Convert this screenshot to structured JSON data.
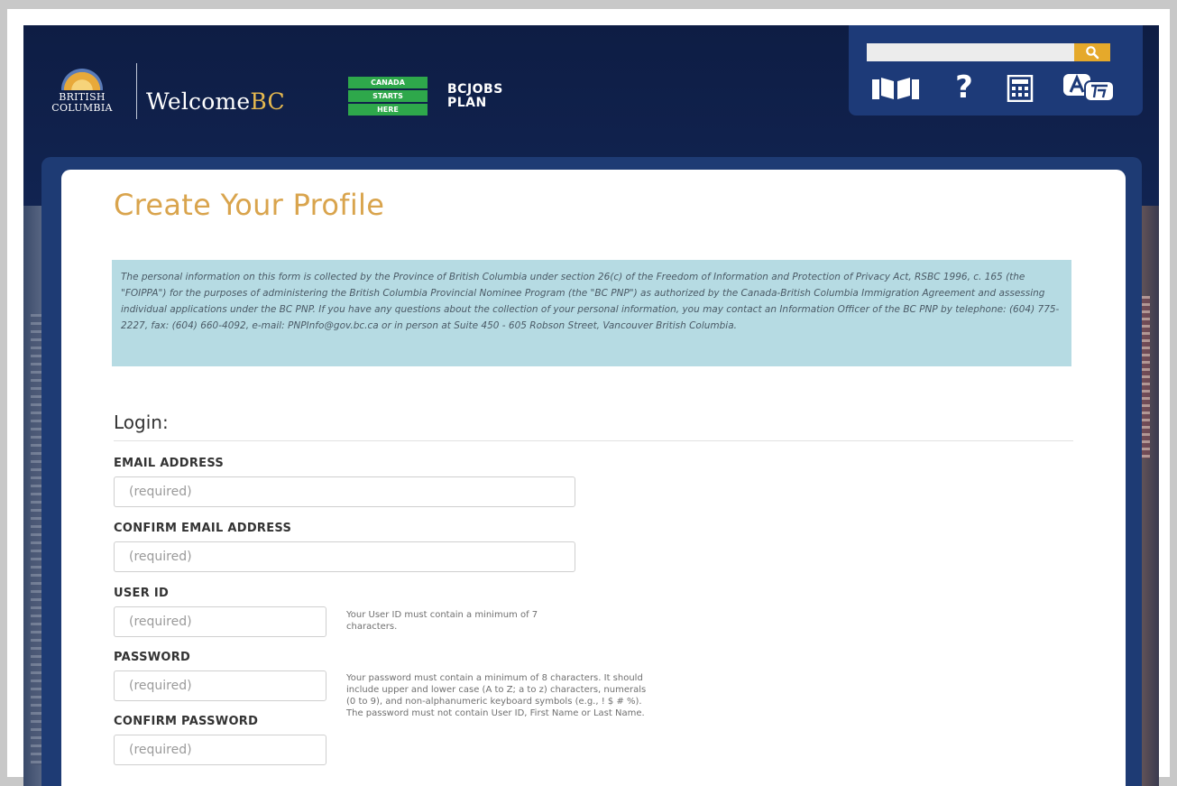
{
  "header": {
    "bc_logo_line1": "BRITISH",
    "bc_logo_line2": "COLUMBIA",
    "welcome_prefix": "Welcome",
    "welcome_suffix": "BC",
    "canada_starts_here": [
      "CANADA",
      "STARTS",
      "HERE"
    ],
    "bcjobs_line1": "BCJOBS",
    "bcjobs_line2": "PLAN"
  },
  "utility": {
    "search_placeholder": "",
    "icons": [
      "book-icon",
      "help-icon",
      "calculator-icon",
      "translate-icon"
    ],
    "help_glyph": "?"
  },
  "page": {
    "title": "Create Your Profile",
    "notice": "The personal information on this form is collected by the Province of British Columbia under section 26(c) of the Freedom of Information and Protection of Privacy Act, RSBC 1996, c. 165 (the \"FOIPPA\") for the purposes of administering the British Columbia Provincial Nominee Program (the \"BC PNP\") as authorized by the Canada-British Columbia Immigration Agreement and assessing individual applications under the BC PNP. If you have any questions about the collection of your personal information, you may contact an Information Officer of the BC PNP by telephone: (604) 775-2227, fax: (604) 660-4092, e-mail: PNPInfo@gov.bc.ca or in person at Suite 450 - 605 Robson Street, Vancouver British Columbia."
  },
  "login": {
    "heading": "Login:",
    "email_label": "EMAIL ADDRESS",
    "email_placeholder": "(required)",
    "confirm_email_label": "CONFIRM EMAIL ADDRESS",
    "confirm_email_placeholder": "(required)",
    "userid_label": "USER ID",
    "userid_placeholder": "(required)",
    "userid_hint": "Your User ID must contain a minimum of 7 characters.",
    "password_label": "PASSWORD",
    "password_placeholder": "(required)",
    "password_hint": "Your password must contain a minimum of 8 characters. It should include upper and lower case (A to Z; a to z) characters, numerals (0 to 9), and non-alphanumeric keyboard symbols (e.g., ! $ # %). The password must not contain User ID, First Name or Last Name.",
    "confirm_password_label": "CONFIRM PASSWORD",
    "confirm_password_placeholder": "(required)"
  },
  "colors": {
    "header_bg": "#0e1d44",
    "utility_bg": "#1d3a78",
    "search_button": "#e5a92b",
    "title": "#d9a44d",
    "notice_bg": "#b6dbe3",
    "brand_green": "#2ea84b"
  }
}
